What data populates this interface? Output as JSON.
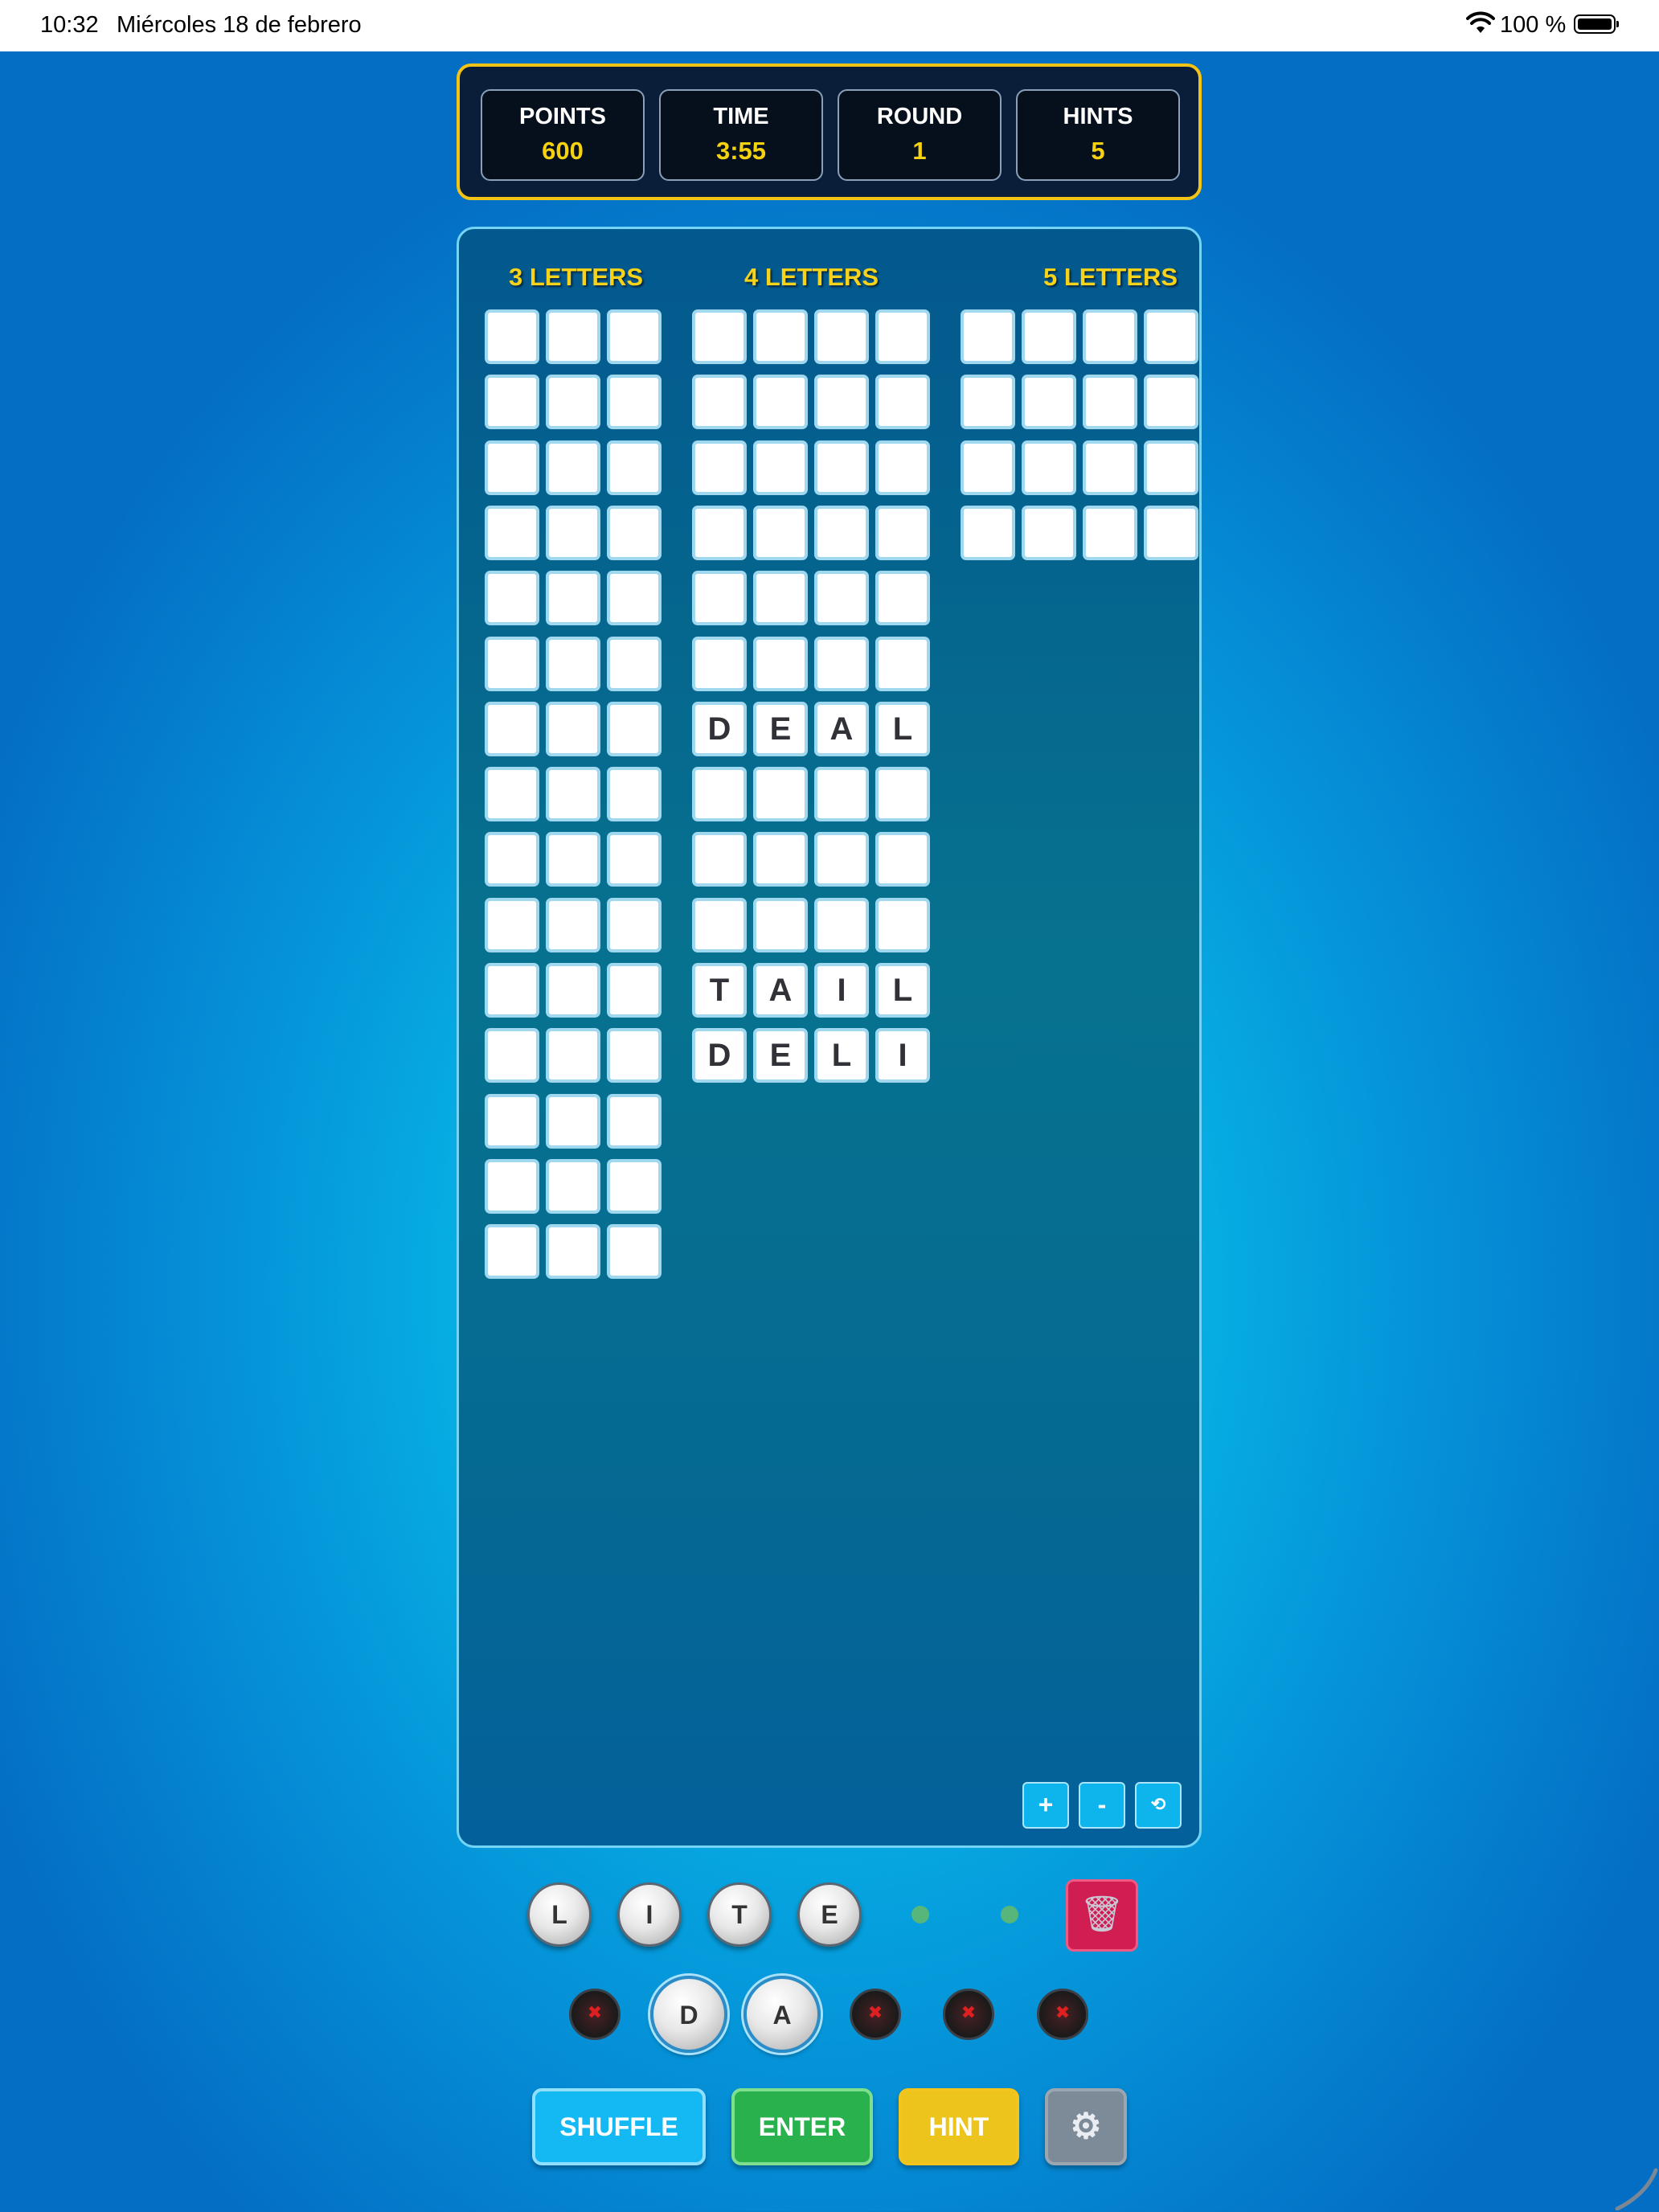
{
  "status": {
    "time": "10:32",
    "date": "Miércoles 18 de febrero",
    "battery": "100 %"
  },
  "scoreboard": {
    "stats": [
      {
        "label": "POINTS",
        "value": "600"
      },
      {
        "label": "TIME",
        "value": "3:55"
      },
      {
        "label": "ROUND",
        "value": "1"
      },
      {
        "label": "HINTS",
        "value": "5"
      }
    ]
  },
  "board": {
    "columns": [
      {
        "heading": "3 LETTERS",
        "length": 3,
        "rows": 15,
        "words": {}
      },
      {
        "heading": "4 LETTERS",
        "length": 4,
        "rows": 12,
        "words": {
          "6": "DEAL",
          "10": "TAIL",
          "11": "DELI"
        }
      },
      {
        "heading": "5 LETTERS",
        "length": 5,
        "rows": 4,
        "words": {}
      }
    ],
    "zoom_controls": {
      "zoom_in": "+",
      "zoom_out": "-",
      "reset": "⟲"
    }
  },
  "letters": {
    "pool": [
      "L",
      "I",
      "T",
      "E"
    ],
    "empty_pool_slots": 2,
    "current_word": [
      "D",
      "A"
    ],
    "empty_word_slots": 4
  },
  "actions": {
    "shuffle": "SHUFFLE",
    "enter": "ENTER",
    "hint": "HINT",
    "settings_icon": "⚙",
    "trash_icon": "🗑"
  },
  "colors": {
    "accent_gold": "#f5d20f",
    "board_border": "#74d4f6",
    "shuffle": "#14b8f2",
    "enter": "#28b14c",
    "hint": "#edc41c",
    "trash": "#d01e52"
  }
}
